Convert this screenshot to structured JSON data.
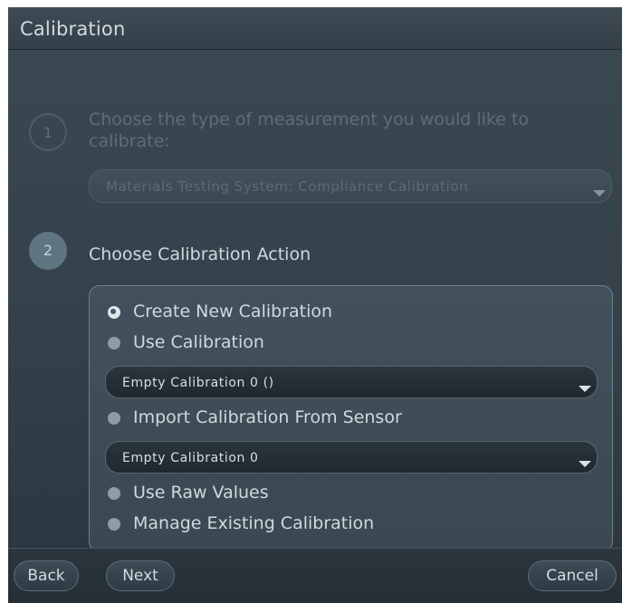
{
  "window": {
    "title": "Calibration"
  },
  "step1": {
    "number": "1",
    "text": "Choose the type of measurement you would like to calibrate:",
    "measurement_select": {
      "value": "Materials Testing System: Compliance Calibration"
    }
  },
  "step2": {
    "number": "2",
    "text": "Choose Calibration Action",
    "options": [
      {
        "label": "Create New Calibration",
        "checked": true
      },
      {
        "label": "Use Calibration",
        "checked": false
      },
      {
        "label": "Import Calibration From Sensor",
        "checked": false
      },
      {
        "label": "Use Raw Values",
        "checked": false
      },
      {
        "label": "Manage Existing Calibration",
        "checked": false
      }
    ],
    "use_calibration_select": {
      "value": "Empty Calibration 0 ()"
    },
    "import_sensor_select": {
      "value": "Empty Calibration 0"
    }
  },
  "footer": {
    "back_label": "Back",
    "next_label": "Next",
    "cancel_label": "Cancel"
  },
  "colors": {
    "background": "#1d262c",
    "panel": "#3a4852",
    "text": "#d0d9de",
    "disabled_text": "#5f6d76",
    "accent_circle": "#5f7582"
  }
}
